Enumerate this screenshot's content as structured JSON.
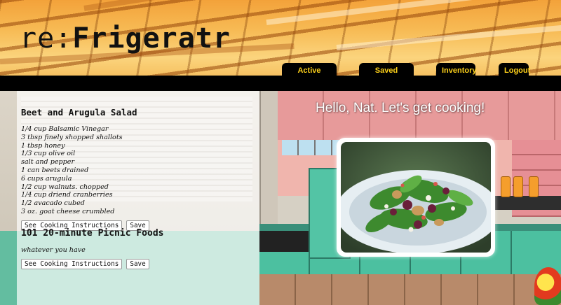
{
  "app": {
    "logo_prefix": "re:",
    "logo_brand": "Frigeratr"
  },
  "nav": {
    "tabs": [
      {
        "label": "Active Recipes"
      },
      {
        "label": "Saved Recipes"
      },
      {
        "label": "Inventory"
      },
      {
        "label": "Logout"
      }
    ]
  },
  "colors": {
    "nav_background": "#000000",
    "nav_text": "#ffd21a"
  },
  "greeting": "Hello, Nat. Let's get cooking!",
  "recipes": [
    {
      "title": "Beet and Arugula Salad",
      "ingredients": [
        "1/4 cup Balsamic Vinegar",
        "3 tbsp finely shopped shallots",
        "1 tbsp honey",
        "1/3 cup olive oil",
        "salt and pepper",
        "1 can beets drained",
        "6 cups arugula",
        "1/2 cup walnuts. chopped",
        "1/4 cup driend cranberries",
        "1/2 avacado cubed",
        "3 oz. goat cheese crumbled"
      ],
      "instructions_button": "See Cooking Instructions",
      "save_button": "Save"
    },
    {
      "title": "101 20-minute Picnic Foods",
      "ingredients": [
        "whatever you have"
      ],
      "instructions_button": "See Cooking Instructions",
      "save_button": "Save"
    }
  ],
  "photo": {
    "icon": "salad-photo"
  }
}
